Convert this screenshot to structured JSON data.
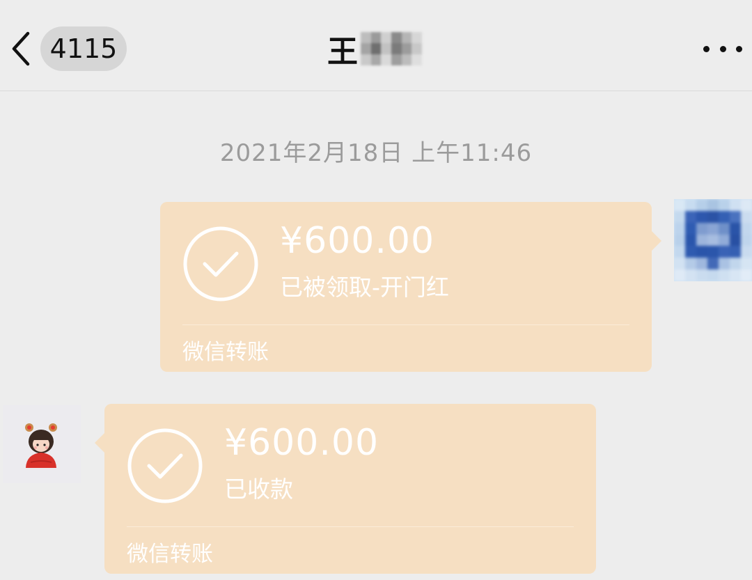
{
  "header": {
    "back_icon": "chevron-left-icon",
    "badge_count": "4115",
    "title": "王",
    "more_icon": "more-horizontal-icon"
  },
  "timestamp": "2021年2月18日 上午11:46",
  "messages": [
    {
      "side": "right",
      "type": "transfer",
      "amount": "¥600.00",
      "status": "已被领取-开门红",
      "footer": "微信转账",
      "icon": "check-circle-icon"
    },
    {
      "side": "left",
      "type": "transfer",
      "amount": "¥600.00",
      "status": "已收款",
      "footer": "微信转账",
      "icon": "check-circle-icon"
    }
  ],
  "colors": {
    "background": "#ededed",
    "bubble": "#f6dfc2",
    "bubble_text": "#ffffff",
    "timestamp": "#9b9b9b",
    "badge_bg": "#d6d6d6"
  }
}
